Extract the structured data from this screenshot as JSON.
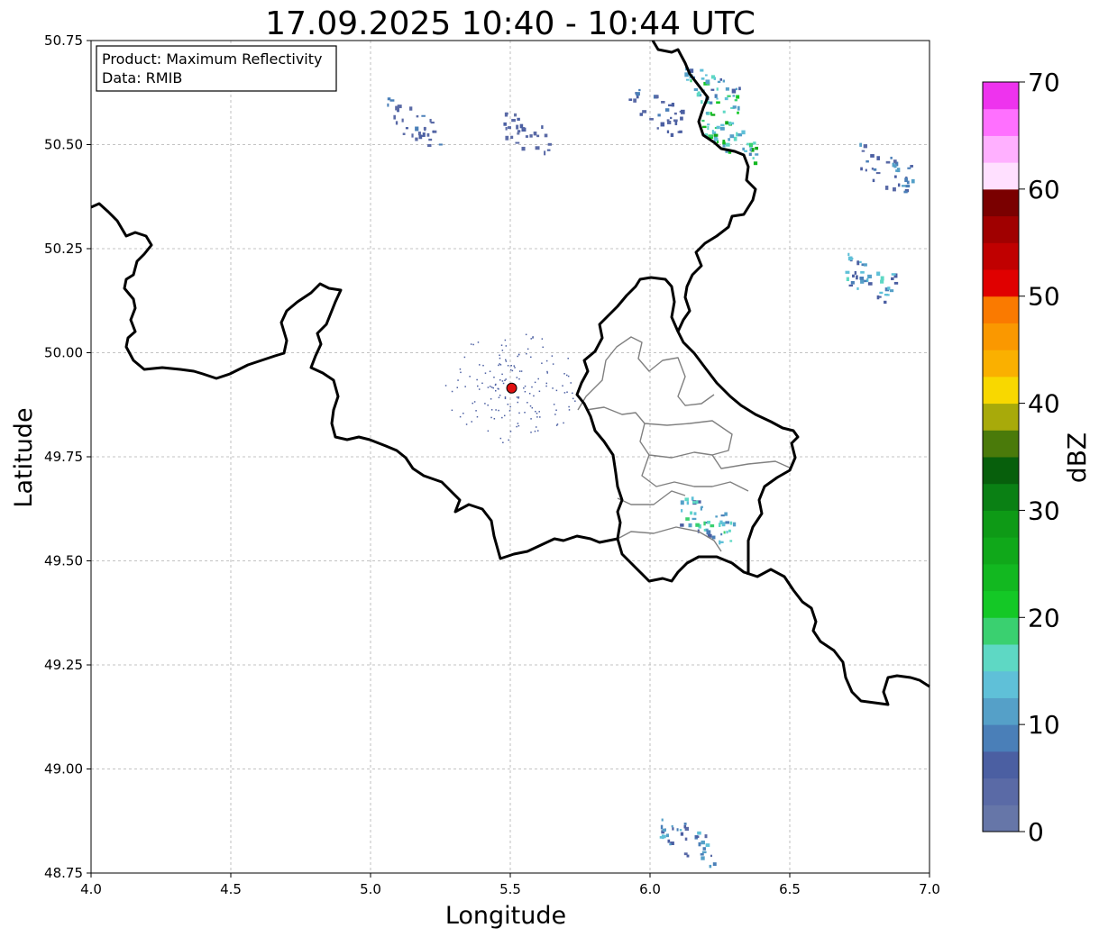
{
  "title": "17.09.2025 10:40 - 10:44 UTC",
  "xlabel": "Longitude",
  "ylabel": "Latitude",
  "info": {
    "product": "Product: Maximum Reflectivity",
    "data": "Data: RMIB"
  },
  "x_ticks": [
    "4.0",
    "4.5",
    "5.0",
    "5.5",
    "6.0",
    "6.5",
    "7.0"
  ],
  "y_ticks": [
    "50.75",
    "50.50",
    "50.25",
    "50.00",
    "49.75",
    "49.50",
    "49.25",
    "49.00",
    "48.75"
  ],
  "colorbar": {
    "label": "dBZ",
    "ticks": [
      "0",
      "10",
      "20",
      "30",
      "40",
      "50",
      "60",
      "70"
    ],
    "colors": [
      "#6676a8",
      "#5a6aa6",
      "#4b5fa2",
      "#4a7fb8",
      "#55a0c8",
      "#5fc0d8",
      "#5ed8c4",
      "#3ad070",
      "#14c826",
      "#12b820",
      "#10a81a",
      "#0e9a16",
      "#0a8014",
      "#075f0c",
      "#4a7a0a",
      "#a8aa0a",
      "#f8d800",
      "#fab000",
      "#fa9800",
      "#fa7a00",
      "#e00000",
      "#c00000",
      "#a00000",
      "#7a0000",
      "#ffe0ff",
      "#ffb0ff",
      "#ff70ff",
      "#ee33ee"
    ],
    "range": [
      0,
      70
    ]
  },
  "radar_site": {
    "lon": 5.505,
    "lat": 49.915,
    "color": "#e01010"
  },
  "chart_data": {
    "type": "map",
    "title": "17.09.2025 10:40 - 10:44 UTC",
    "xlabel": "Longitude",
    "ylabel": "Latitude",
    "xlim": [
      4.0,
      7.0
    ],
    "ylim": [
      48.75,
      50.75
    ],
    "grid": true,
    "colorbar_label": "dBZ",
    "colorbar_range": [
      0,
      70
    ],
    "radar_site": [
      5.505,
      49.915
    ],
    "echoes": [
      {
        "lon": 6.28,
        "lat": 50.52,
        "dbz": 25
      },
      {
        "lon": 6.22,
        "lat": 50.63,
        "dbz": 20
      },
      {
        "lon": 6.78,
        "lat": 50.18,
        "dbz": 15
      },
      {
        "lon": 6.84,
        "lat": 50.44,
        "dbz": 10
      },
      {
        "lon": 6.02,
        "lat": 50.58,
        "dbz": 8
      },
      {
        "lon": 5.15,
        "lat": 50.55,
        "dbz": 8
      },
      {
        "lon": 5.55,
        "lat": 50.53,
        "dbz": 6
      },
      {
        "lon": 6.2,
        "lat": 49.6,
        "dbz": 18
      },
      {
        "lon": 6.13,
        "lat": 48.83,
        "dbz": 12
      }
    ]
  }
}
